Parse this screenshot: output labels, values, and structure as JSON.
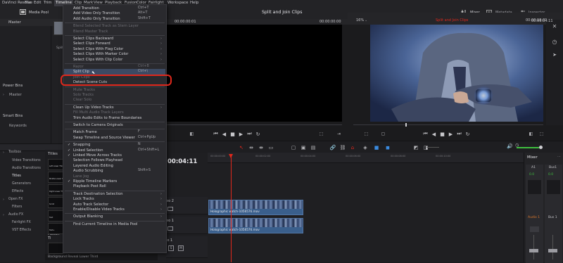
{
  "menubar": {
    "items": [
      "DaVinci Resolve",
      "File",
      "Edit",
      "Trim",
      "Timeline",
      "Clip",
      "Mark",
      "View",
      "Playback",
      "Fusion",
      "Color",
      "Fairlight",
      "Workspace",
      "Help"
    ],
    "active_index": 4
  },
  "toolbar": {
    "media_pool": "Media Pool",
    "project_title": "Split and Join Clips",
    "mixer": "Mixer",
    "metadata": "Metadata",
    "inspector": "Inspector"
  },
  "left_panel": {
    "master_bin": "Master",
    "power_bins_title": "Power Bins",
    "power_bins_master": "Master",
    "smart_bins_title": "Smart Bins",
    "keywords": "Keywords",
    "clip_label": "Split",
    "toolbox_items": [
      "Toolbox",
      "Video Transitions",
      "Audio Transitions",
      "Titles",
      "Generators",
      "Effects",
      "Open FX",
      "Filters",
      "Audio FX",
      "Fairlight FX",
      "VST Effects"
    ],
    "titles_header": "Titles",
    "fusion_titles_header": "Fusion Ti",
    "title_thumbs": [
      "Left Lower Third",
      "Middle Lower Third",
      "Right Lower Third",
      "Scroll",
      "Text",
      "Text+"
    ],
    "bottom_item": "Background Reveal Lower Third"
  },
  "source_viewer": {
    "timecode": "00:00:00:01",
    "right_timecode": "00:00:00:00"
  },
  "timeline_viewer": {
    "zoom": "16%",
    "timecode": "00:00:19:01",
    "clip_name": "Split and Join Clips",
    "duration": "00:00:04:11"
  },
  "timeline": {
    "timecode": "00:04:11",
    "ruler_ticks": [
      "00:00:00:00",
      "00:00:02:00",
      "00:00:04:00",
      "00:00:06:00",
      "00:00:08:00",
      "00:00:10:00"
    ],
    "tracks": [
      {
        "label": "eo 2",
        "clip_name": "Holographic watch-1056576.mov"
      },
      {
        "label": "eo 1",
        "clip_name": "Holographic watch-1056576.mov"
      }
    ],
    "audio_label": "io 1"
  },
  "mixer": {
    "title": "Mixer",
    "channels": [
      "A1",
      "Bus1"
    ],
    "channel_values": [
      "0.0",
      "0.0"
    ],
    "bottom_labels": [
      "Audio 1",
      "Bus 1"
    ],
    "meter_color": "#3fbf3f"
  },
  "timeline_menu": {
    "items": [
      {
        "label": "Add Transition",
        "shortcut": "Ctrl+T",
        "dim": false
      },
      {
        "label": "Add Video Only Transition",
        "shortcut": "Alt+T",
        "dim": false
      },
      {
        "label": "Add Audio Only Transition",
        "shortcut": "Shift+T",
        "dim": false
      },
      {
        "sep": true
      },
      {
        "label": "Blend Selected Track as Stem Layer",
        "shortcut": "",
        "dim": true
      },
      {
        "label": "Blend Master Track",
        "shortcut": "",
        "dim": true
      },
      {
        "sep": true
      },
      {
        "label": "Select Clips Backward",
        "shortcut": "",
        "dim": false,
        "submenu": true
      },
      {
        "label": "Select Clips Forward",
        "shortcut": "",
        "dim": false,
        "submenu": true
      },
      {
        "label": "Select Clips With Flag Color",
        "shortcut": "",
        "dim": false,
        "submenu": true
      },
      {
        "label": "Select Clips With Marker Color",
        "shortcut": "",
        "dim": false,
        "submenu": true
      },
      {
        "label": "Select Clips With Clip Color",
        "shortcut": "",
        "dim": false,
        "submenu": true
      },
      {
        "sep": true
      },
      {
        "label": "Razor",
        "shortcut": "Ctrl+B",
        "dim": true
      },
      {
        "label": "Split Clip",
        "shortcut": "Ctrl+\\",
        "dim": false,
        "highlight": true
      },
      {
        "label": "Join Clips",
        "shortcut": "",
        "dim": true
      },
      {
        "label": "Detect Scene Cuts",
        "shortcut": "",
        "dim": false
      },
      {
        "sep": true
      },
      {
        "label": "Mute Tracks",
        "shortcut": "",
        "dim": true
      },
      {
        "label": "Solo Tracks",
        "shortcut": "",
        "dim": true
      },
      {
        "label": "Clear Solo",
        "shortcut": "",
        "dim": true
      },
      {
        "sep": true
      },
      {
        "label": "Clean Up Video Tracks",
        "shortcut": "",
        "dim": false,
        "submenu": true
      },
      {
        "label": "Fill Multi Audio Track Layers",
        "shortcut": "",
        "dim": true
      },
      {
        "label": "Trim Audio Edits to Frame Boundaries",
        "shortcut": "",
        "dim": false
      },
      {
        "sep": true
      },
      {
        "label": "Switch to Camera Originals",
        "shortcut": "",
        "dim": false
      },
      {
        "sep": true
      },
      {
        "label": "Match Frame",
        "shortcut": "F",
        "dim": false
      },
      {
        "label": "Swap Timeline and Source Viewer",
        "shortcut": "Ctrl+PgUp",
        "dim": false
      },
      {
        "sep": true
      },
      {
        "label": "Snapping",
        "shortcut": "N",
        "dim": false,
        "checked": true
      },
      {
        "label": "Linked Selection",
        "shortcut": "Ctrl+Shift+L",
        "dim": false,
        "checked": true
      },
      {
        "label": "Linked Move Across Tracks",
        "shortcut": "",
        "dim": false,
        "checked": true
      },
      {
        "label": "Selection Follows Playhead",
        "shortcut": "",
        "dim": false
      },
      {
        "label": "Layered Audio Editing",
        "shortcut": "",
        "dim": false
      },
      {
        "label": "Audio Scrubbing",
        "shortcut": "Shift+S",
        "dim": false
      },
      {
        "label": "Lane Jog",
        "shortcut": "",
        "dim": true
      },
      {
        "label": "Ripple Timeline Markers",
        "shortcut": "",
        "dim": false,
        "checked": true
      },
      {
        "label": "Playback Post Roll",
        "shortcut": "",
        "dim": false
      },
      {
        "sep": true
      },
      {
        "label": "Track Destination Selection",
        "shortcut": "",
        "dim": false,
        "submenu": true
      },
      {
        "label": "Lock Tracks",
        "shortcut": "",
        "dim": false,
        "submenu": true
      },
      {
        "label": "Auto Track Selector",
        "shortcut": "",
        "dim": false,
        "submenu": true
      },
      {
        "label": "Enable/Disable Video Tracks",
        "shortcut": "",
        "dim": false,
        "submenu": true
      },
      {
        "sep": true
      },
      {
        "label": "Output Blanking",
        "shortcut": "",
        "dim": false,
        "submenu": true
      },
      {
        "sep": true
      },
      {
        "label": "Find Current Timeline in Media Pool",
        "shortcut": "",
        "dim": false
      }
    ]
  },
  "colors": {
    "accent_red": "#e0281c",
    "playhead": "#e0281c",
    "clip_blue": "#3a5f8c",
    "menu_highlight": "#3c4a63"
  }
}
